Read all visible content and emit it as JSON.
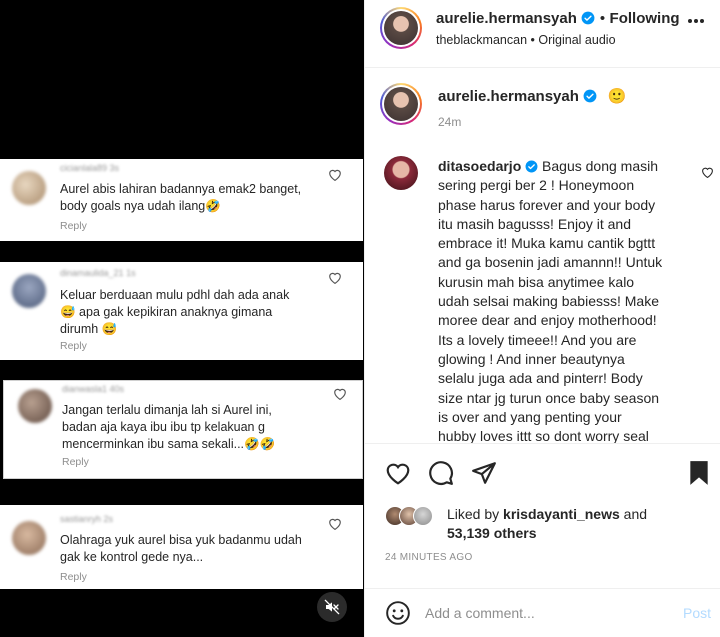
{
  "video": {
    "comments": [
      {
        "username": "cicianlala89",
        "time": "3s",
        "text_lines": [
          "Aurel abis lahiran badannya emak2 banget,",
          "body goals nya udah ilang🤣"
        ],
        "reply": "Reply"
      },
      {
        "username": "dinamaulida_21",
        "time": "1s",
        "text_lines": [
          "Keluar berduaan mulu pdhl dah ada anak",
          "😅 apa gak kepikiran anaknya gimana",
          "dirumh 😅"
        ],
        "reply": "Reply"
      },
      {
        "username": "dianwasla1",
        "time": "40s",
        "text_lines": [
          "Jangan terlalu dimanja lah si Aurel ini,",
          "badan aja kaya ibu ibu tp kelakuan g",
          "mencerminkan ibu sama sekali...🤣🤣"
        ],
        "reply": "Reply"
      },
      {
        "username": "sastianryh",
        "time": "2s",
        "text_lines": [
          "Olahraga yuk aurel bisa yuk badanmu udah",
          "gak ke kontrol gede nya..."
        ],
        "reply": "Reply"
      }
    ],
    "mute_icon": "speaker-muted-icon"
  },
  "header": {
    "username": "aurelie.hermansyah",
    "dot": "•",
    "follow_label": "Following",
    "audio_user": "theblackmancan",
    "audio_sep": "•",
    "audio_label": "Original audio",
    "more_icon": "more-horizontal-icon"
  },
  "caption": {
    "username": "aurelie.hermansyah",
    "emoji": "🙂",
    "time": "24m"
  },
  "comment": {
    "username": "ditasoedarjo",
    "lines": [
      "Bagus dong masih",
      "sering pergi ber 2 ! Honeymoon",
      "phase harus forever and your body",
      "itu masih bagusss! Enjoy it and",
      "embrace it! Muka kamu cantik bgttt",
      "and ga bosenin jadi amannn!! Untuk",
      "kurusin mah bisa anytimee kalo",
      "udah selsai making babiesss! Make",
      "moree dear and enjoy motherhood!",
      "Its a lovely timeee!! And you are",
      "glowing ! And inner beautynya",
      "selalu juga ada and pinterr! Body",
      "size ntar jg turun once baby season",
      "is over and yang penting your",
      "hubby loves ittt so dont worry seal"
    ]
  },
  "likes": {
    "prefix": "Liked by ",
    "user": "krisdayanti_news",
    "middle": " and",
    "count": "53,139 others",
    "time_ago": "24 MINUTES AGO"
  },
  "add_comment": {
    "placeholder": "Add a comment...",
    "post_label": "Post"
  },
  "colors": {
    "verified": "#0095f6",
    "post_disabled": "#b3dbff",
    "secondary_text": "#8e8e8e"
  }
}
